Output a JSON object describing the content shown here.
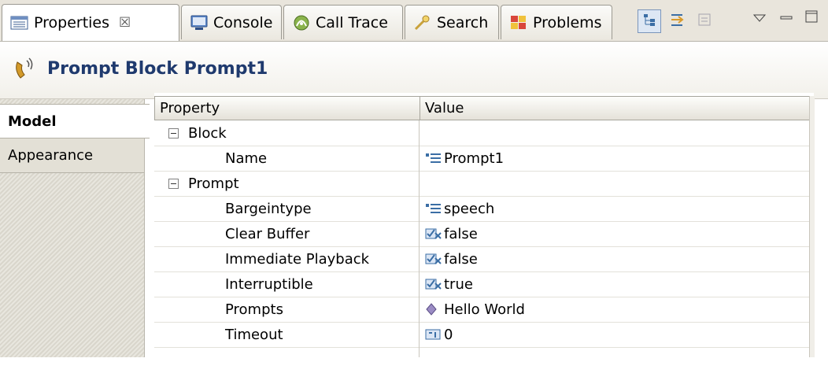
{
  "tabs": [
    {
      "label": "Properties",
      "icon": "properties-view-icon",
      "close": "☒"
    },
    {
      "label": "Console",
      "icon": "console-icon"
    },
    {
      "label": "Call Trace",
      "icon": "call-trace-icon"
    },
    {
      "label": "Search",
      "icon": "search-icon"
    },
    {
      "label": "Problems",
      "icon": "problems-icon"
    }
  ],
  "toolbar": [
    "show-categories-icon",
    "show-advanced-icon",
    "restore-default-icon",
    "view-menu-icon",
    "minimize-icon",
    "maximize-icon"
  ],
  "title": "Prompt Block Prompt1",
  "side_tabs": [
    "Model",
    "Appearance"
  ],
  "table": {
    "headers": [
      "Property",
      "Value"
    ],
    "rows": [
      {
        "property": "Block",
        "value": "",
        "group": true
      },
      {
        "property": "Name",
        "value": "Prompt1",
        "icon": "text-value-icon"
      },
      {
        "property": "Prompt",
        "value": "",
        "group": true
      },
      {
        "property": "Bargeintype",
        "value": "speech",
        "icon": "text-value-icon"
      },
      {
        "property": "Clear Buffer",
        "value": "false",
        "icon": "boolean-value-icon"
      },
      {
        "property": "Immediate Playback",
        "value": "false",
        "icon": "boolean-value-icon"
      },
      {
        "property": "Interruptible",
        "value": "true",
        "icon": "boolean-value-icon"
      },
      {
        "property": "Prompts",
        "value": "Hello World",
        "icon": "prompt-value-icon"
      },
      {
        "property": "Timeout",
        "value": "0",
        "icon": "number-value-icon"
      }
    ]
  },
  "colors": {
    "title": "#1f3a6e",
    "accent_blue": "#3b6ea5",
    "tab_bg": "#e9e5dc"
  }
}
